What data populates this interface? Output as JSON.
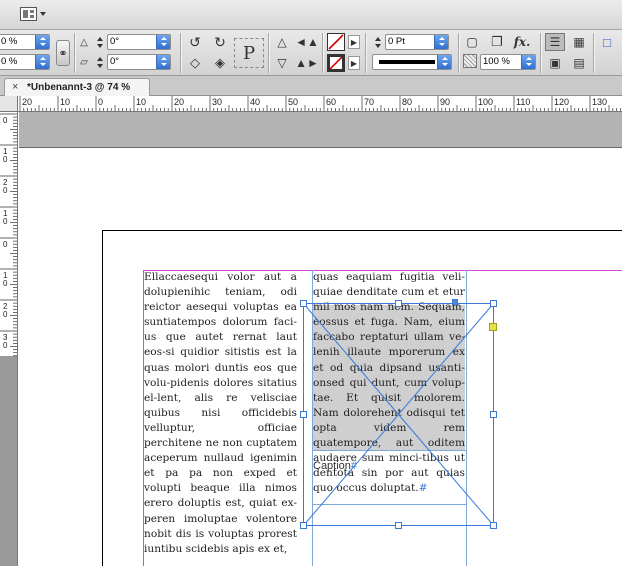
{
  "toolbar": {
    "workspace_menu_icon": "layout-grid-icon",
    "ref_w_pct": "0 %",
    "ref_h_pct": "0 %",
    "rotate_angle": "0°",
    "shear_angle": "0°",
    "stroke_weight": "0 Pt",
    "opacity_pct": "100 %",
    "fx_label": "fx.",
    "type_on_path_label": "P"
  },
  "tab": {
    "close": "×",
    "title": "*Unbenannt-3 @ 74 %"
  },
  "ruler": {
    "h_labels": [
      "20",
      "10",
      "0",
      "10",
      "20",
      "30",
      "40",
      "50",
      "60",
      "70",
      "80",
      "90",
      "100",
      "110",
      "120",
      "130"
    ],
    "v_labels": [
      "0",
      "1 0",
      "2 0",
      "1 0",
      "0",
      "1 0",
      "2 0",
      "3 0"
    ]
  },
  "document": {
    "column1": "Ellaccaesequi volor aut a dolupienihic teniam, odi reictor aesequi voluptas ea suntiatempos dolorum faci-us que autet rernat laut eos-si quidior sitistis est la quas molori duntis eos que volu-pidenis dolores sitatius el-lent, alis re velisciae quibus nisi officidebis velluptur, officiae perchitene ne non cuptatem aceperum nullaud igenimin et pa pa non exped et volupti beaque illa nimos erero doluptis est, quiat ex-peren imoluptae volentore nobit dis is voluptas prorest iuntibu scidebis apis ex et,",
    "column2": "quas eaquiam fugitia veli-quiae denditate cum et etur mil mos nam nem. Sequam, eossus et fuga. Nam, eium faccabo reptaturi ullam ve-lenih illaute mporerum ex et od quia dipsand usanti-onsed qui dunt, cum volup-tae. Et quisit molorem. Nam dolorehent odisqui tet opta videm rem quatempore, aut oditem audaere sum minci-tibus ut dentota sin por aut quias quo occus doluptat.",
    "column2_end_mark": "#",
    "caption": "Caption",
    "caption_end_mark": "#"
  }
}
